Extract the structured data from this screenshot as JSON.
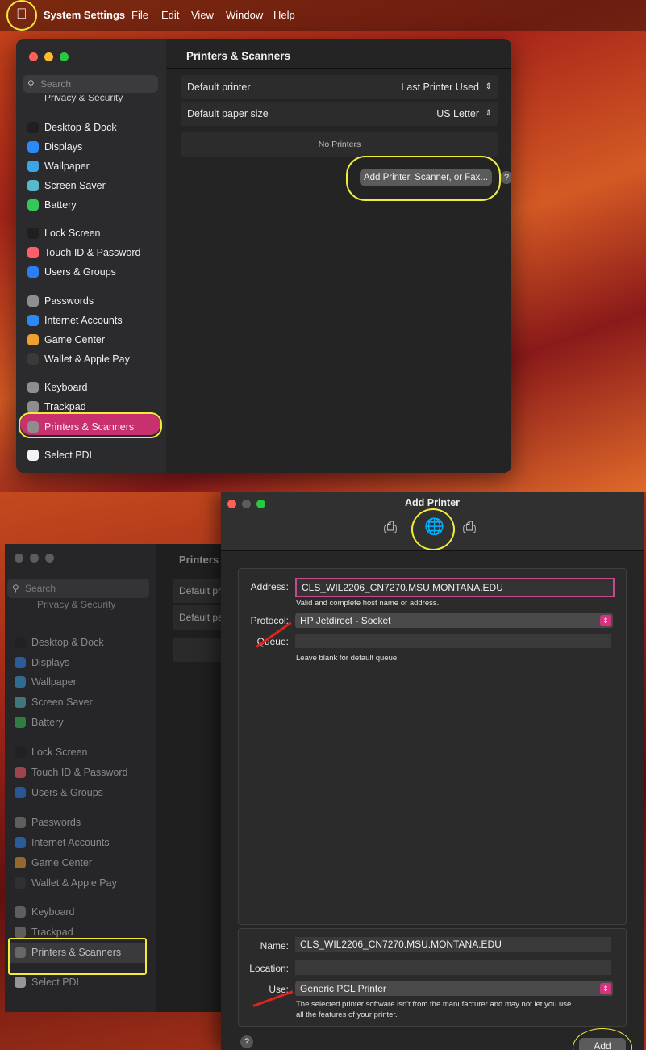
{
  "menubar": {
    "app": "System Settings",
    "items": [
      "File",
      "Edit",
      "View",
      "Window",
      "Help"
    ]
  },
  "search_placeholder": "Search",
  "sidebar_top": {
    "partial_item": "Privacy & Security",
    "items": [
      {
        "label": "Desktop & Dock",
        "color": "#1f1f1f"
      },
      {
        "label": "Displays",
        "color": "#2b8af7"
      },
      {
        "label": "Wallpaper",
        "color": "#3aa6e8"
      },
      {
        "label": "Screen Saver",
        "color": "#57b9c9"
      },
      {
        "label": "Battery",
        "color": "#34c759"
      },
      {
        "label": "Lock Screen",
        "color": "#1f1f1f"
      },
      {
        "label": "Touch ID & Password",
        "color": "#ff5f6b"
      },
      {
        "label": "Users & Groups",
        "color": "#2b7ff2"
      },
      {
        "label": "Passwords",
        "color": "#8e8e8e"
      },
      {
        "label": "Internet Accounts",
        "color": "#2b8af7"
      },
      {
        "label": "Game Center",
        "color": "#f0a030"
      },
      {
        "label": "Wallet & Apple Pay",
        "color": "#3a3a3a"
      },
      {
        "label": "Keyboard",
        "color": "#8e8e8e"
      },
      {
        "label": "Trackpad",
        "color": "#8e8e8e"
      },
      {
        "label": "Printers & Scanners",
        "color": "#8e8e8e"
      },
      {
        "label": "Select PDL",
        "color": "#f4f4f4"
      }
    ]
  },
  "main": {
    "title": "Printers & Scanners",
    "default_printer_label": "Default printer",
    "default_printer_value": "Last Printer Used",
    "paper_label": "Default paper size",
    "paper_value": "US Letter",
    "no_printers": "No Printers",
    "add_button": "Add Printer, Scanner, or Fax...",
    "help": "?"
  },
  "bottom_bg": {
    "printers_partial": "Printers",
    "default_pr_partial": "Default pr",
    "default_pa_partial": "Default pa"
  },
  "add_printer": {
    "title": "Add Printer",
    "address_label": "Address:",
    "address_value": "CLS_WIL2206_CN7270.MSU.MONTANA.EDU",
    "address_hint": "Valid and complete host name or address.",
    "protocol_label": "Protocol:",
    "protocol_value": "HP Jetdirect - Socket",
    "queue_label": "Queue:",
    "queue_value": "",
    "queue_hint": "Leave blank for default queue.",
    "name_label": "Name:",
    "name_value": "CLS_WIL2206_CN7270.MSU.MONTANA.EDU",
    "location_label": "Location:",
    "location_value": "",
    "use_label": "Use:",
    "use_value": "Generic PCL Printer",
    "use_hint_1": "The selected printer software isn't from the manufacturer and may not let you use",
    "use_hint_2": "all the features of your printer.",
    "help": "?",
    "add_button": "Add"
  }
}
